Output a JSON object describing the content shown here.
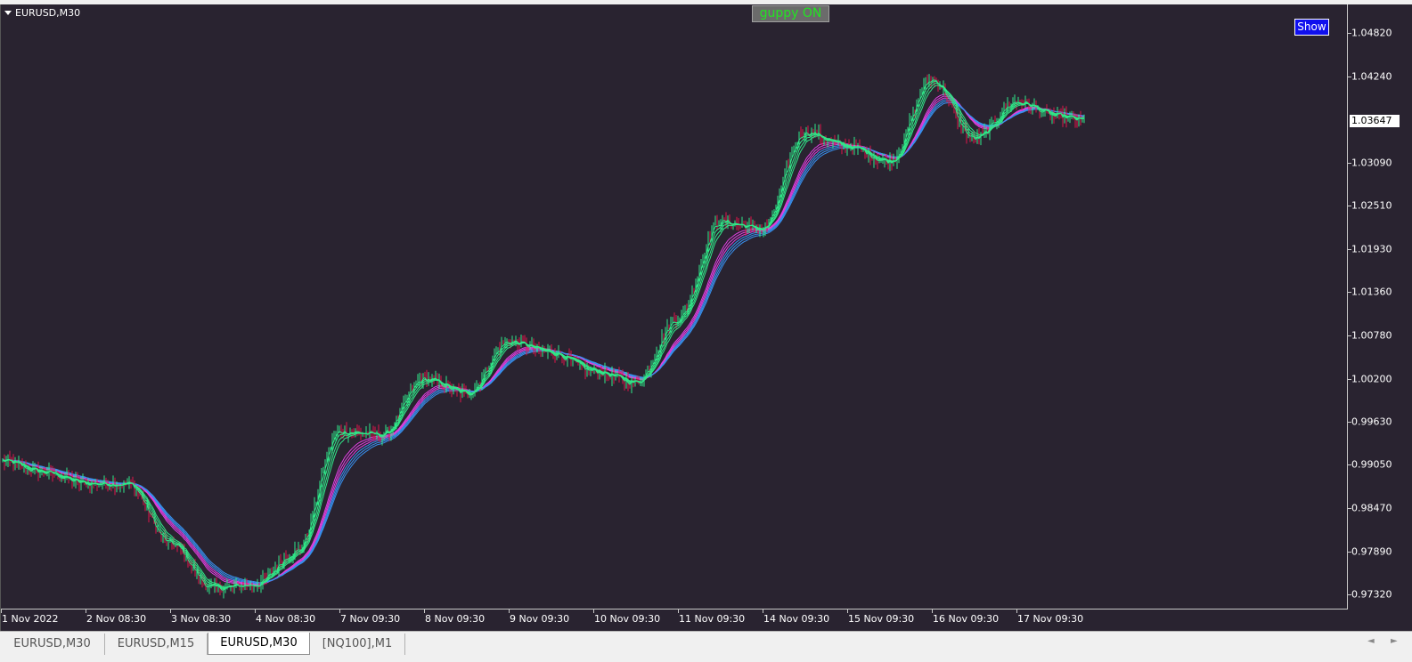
{
  "chart_window": {
    "symbol_label": "EURUSD,M30",
    "guppy_button_label": "guppy ON",
    "show_button_label": "Show",
    "colors": {
      "background": "#292330",
      "bull_candle": "#2ee88a",
      "bear_candle": "#e0144a",
      "short_ema": "#30e888",
      "long_ema_fast": "#e040e0",
      "long_ema_slow": "#3890ee",
      "guppy_text": "#22e422",
      "show_button_bg": "#1010ee"
    },
    "price_axis": {
      "labels": [
        "1.04820",
        "1.04240",
        "1.03090",
        "1.02510",
        "1.01930",
        "1.01360",
        "1.00780",
        "1.00200",
        "0.99630",
        "0.99050",
        "0.98470",
        "0.97890",
        "0.97320"
      ],
      "current_price": "1.03647"
    },
    "time_axis": {
      "labels": [
        "1 Nov 2022",
        "2 Nov 08:30",
        "3 Nov 08:30",
        "4 Nov 08:30",
        "7 Nov 09:30",
        "8 Nov 09:30",
        "9 Nov 09:30",
        "10 Nov 09:30",
        "11 Nov 09:30",
        "14 Nov 09:30",
        "15 Nov 09:30",
        "16 Nov 09:30",
        "17 Nov 09:30"
      ]
    }
  },
  "chart_data": {
    "type": "line",
    "title": "",
    "xlabel": "",
    "ylabel": "",
    "ylim": [
      0.971,
      1.051
    ],
    "x_day_index": [
      0,
      0.5,
      1,
      1.5,
      2,
      2.5,
      3,
      3.5,
      4,
      4.5,
      5,
      5.5,
      6,
      6.5,
      7,
      7.5,
      8,
      8.5,
      9,
      9.5,
      10,
      10.5,
      11,
      11.5,
      12,
      12.5,
      12.8
    ],
    "close_path": [
      0.991,
      0.9895,
      0.988,
      0.988,
      0.98,
      0.974,
      0.9745,
      0.979,
      0.995,
      0.9945,
      1.002,
      1.0,
      1.007,
      1.0055,
      1.003,
      1.0015,
      1.01,
      1.023,
      1.022,
      1.035,
      1.033,
      1.031,
      1.042,
      1.034,
      1.039,
      1.037,
      1.0365
    ],
    "grid": false,
    "legend": "none"
  },
  "tab_bar": {
    "tabs": [
      {
        "label": "EURUSD,M30",
        "active": false
      },
      {
        "label": "EURUSD,M15",
        "active": false
      },
      {
        "label": "EURUSD,M30",
        "active": true
      },
      {
        "label": "[NQ100],M1",
        "active": false
      }
    ],
    "scroll_left": "◄",
    "scroll_right": "►"
  }
}
